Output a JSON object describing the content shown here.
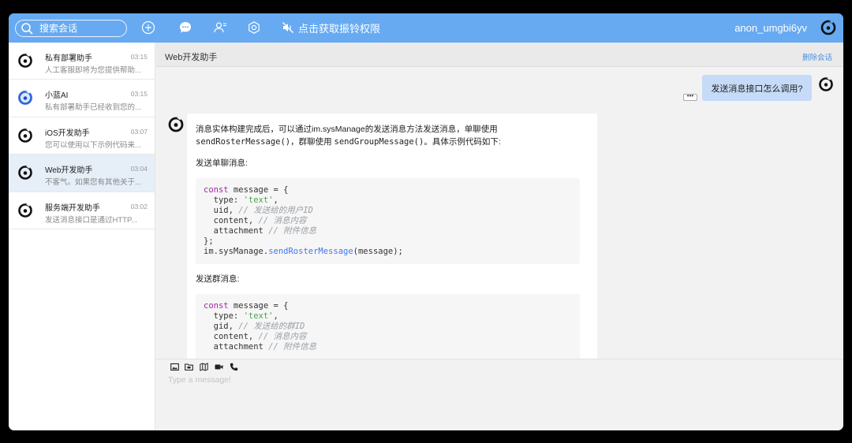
{
  "colors": {
    "accent": "#67aaf2",
    "link": "#4a90e2",
    "active_row": "#e6eef8",
    "user_bubble": "#c5dbf8"
  },
  "topbar": {
    "search_placeholder": "搜索会话",
    "icons": [
      "search-icon",
      "plus-circle-icon",
      "chat-bubble-icon",
      "contacts-icon",
      "settings-gear-icon"
    ],
    "ring_permission_label": "点击获取振铃权限",
    "username": "anon_umgbi6yv"
  },
  "sidebar": {
    "conversations": [
      {
        "name": "私有部署助手",
        "time": "03:15",
        "preview": "人工客服即将为您提供帮助...",
        "avatar": "dark",
        "active": false
      },
      {
        "name": "小蓝AI",
        "time": "03:15",
        "preview": "私有部署助手已经收到您的...",
        "avatar": "blue",
        "active": false
      },
      {
        "name": "iOS开发助手",
        "time": "03:07",
        "preview": "您可以使用以下示例代码来...",
        "avatar": "dark",
        "active": false
      },
      {
        "name": "Web开发助手",
        "time": "03:04",
        "preview": "不客气。如果您有其他关于...",
        "avatar": "dark",
        "active": true
      },
      {
        "name": "服务端开发助手",
        "time": "03:02",
        "preview": "发送消息接口是通过HTTP...",
        "avatar": "dark",
        "active": false
      }
    ]
  },
  "chat": {
    "title": "Web开发助手",
    "delete_label": "删除会话",
    "user_message": "发送消息接口怎么调用?",
    "more_label": "•••",
    "bot": {
      "intro_pre": "消息实体构建完成后，可以通过im.sysManage的发送消息方法发送消息，单聊使用 ",
      "intro_code1": "sendRosterMessage()",
      "intro_mid": "，群聊使用 ",
      "intro_code2": "sendGroupMessage()",
      "intro_post": "。具体示例代码如下:",
      "single_heading": "发送单聊消息:",
      "group_heading": "发送群消息:",
      "code_single": {
        "l1_kw": "const",
        "l1_rest": " message = {",
        "l2_key": "  type: ",
        "l2_str": "'text'",
        "l2_end": ",",
        "l3_key": "  uid, ",
        "l3_cmt": "// 发送给的用户ID",
        "l4_key": "  content, ",
        "l4_cmt": "// 消息内容",
        "l5_key": "  attachment ",
        "l5_cmt": "// 附件信息",
        "l6": "};",
        "l7_obj": "im.sysManage.",
        "l7_fn": "sendRosterMessage",
        "l7_end": "(message);"
      },
      "code_group": {
        "l1_kw": "const",
        "l1_rest": " message = {",
        "l2_key": "  type: ",
        "l2_str": "'text'",
        "l2_end": ",",
        "l3_key": "  gid, ",
        "l3_cmt": "// 发送给的群ID",
        "l4_key": "  content, ",
        "l4_cmt": "// 消息内容",
        "l5_key": "  attachment ",
        "l5_cmt": "// 附件信息"
      }
    }
  },
  "composer": {
    "tools": [
      "image-icon",
      "folder-icon",
      "location-icon",
      "video-call-icon",
      "phone-icon"
    ],
    "placeholder": "Type a message!"
  }
}
